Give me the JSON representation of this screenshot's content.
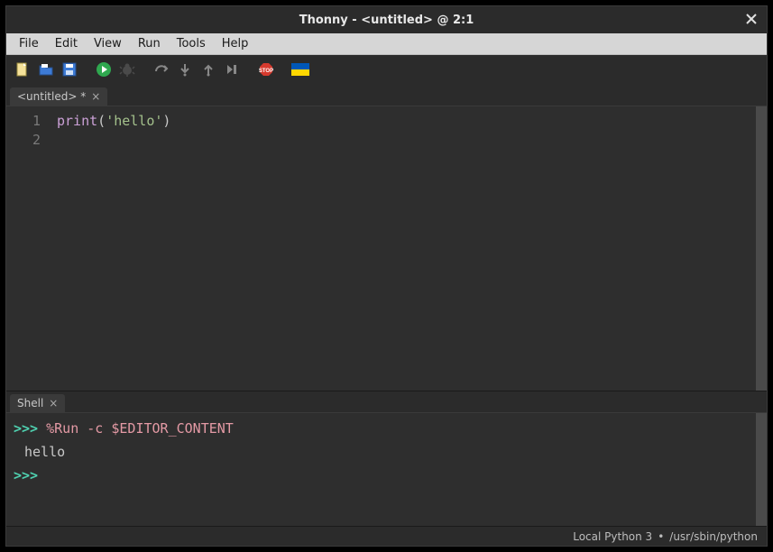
{
  "title": "Thonny  -  <untitled>  @  2:1",
  "menubar": [
    "File",
    "Edit",
    "View",
    "Run",
    "Tools",
    "Help"
  ],
  "toolbar_icons": [
    "new-file-icon",
    "open-file-icon",
    "save-file-icon",
    "run-icon",
    "debug-icon",
    "step-over-icon",
    "step-into-icon",
    "step-out-icon",
    "resume-icon",
    "stop-icon",
    "ukraine-flag-icon"
  ],
  "editor_tab": {
    "label": "<untitled> *"
  },
  "code": {
    "lines": [
      {
        "n": "1",
        "tokens": [
          {
            "t": "print",
            "cls": "tok-builtin"
          },
          {
            "t": "(",
            "cls": "tok-paren"
          },
          {
            "t": "'hello'",
            "cls": "tok-string"
          },
          {
            "t": ")",
            "cls": "tok-paren"
          }
        ]
      },
      {
        "n": "2",
        "tokens": []
      }
    ]
  },
  "shell_tab": {
    "label": "Shell"
  },
  "shell": {
    "prompt": ">>>",
    "lines": [
      {
        "kind": "cmd",
        "text": "%Run -c $EDITOR_CONTENT"
      },
      {
        "kind": "out",
        "text": "hello"
      },
      {
        "kind": "prompt",
        "text": ""
      }
    ]
  },
  "status": {
    "interp": "Local Python 3",
    "sep": "•",
    "path": "/usr/sbin/python"
  }
}
